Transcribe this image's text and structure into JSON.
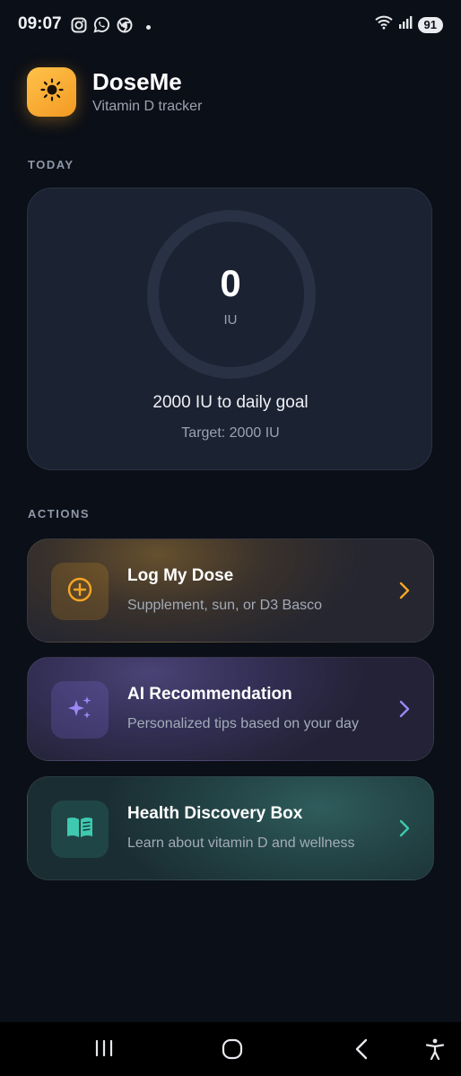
{
  "status_bar": {
    "time": "09:07",
    "battery": "91",
    "left_icons": [
      "instagram-icon",
      "whatsapp-icon",
      "chrome-icon",
      "dot-icon"
    ],
    "right_icons": [
      "wifi-icon",
      "signal-icon",
      "battery-icon"
    ]
  },
  "header": {
    "app_name": "DoseMe",
    "subtitle": "Vitamin D tracker",
    "logo_icon": "sun-icon"
  },
  "today": {
    "section_label": "TODAY",
    "dose_value": "0",
    "dose_unit": "IU",
    "progress_fraction": 0,
    "goal_text": "2000 IU to daily goal",
    "target_text": "Target: 2000 IU"
  },
  "actions": {
    "section_label": "ACTIONS",
    "items": [
      {
        "title": "Log My Dose",
        "description": "Supplement, sun, or D3 Basco",
        "icon": "plus-circle-icon",
        "accent": "#f5a623"
      },
      {
        "title": "AI Recommendation",
        "description": "Personalized tips based on your day",
        "icon": "sparkles-icon",
        "accent": "#9b87f5"
      },
      {
        "title": "Health Discovery Box",
        "description": "Learn about vitamin D and wellness",
        "icon": "book-icon",
        "accent": "#3ec9b0"
      }
    ]
  },
  "nav_bar": {
    "buttons": [
      "recent-apps-icon",
      "home-icon",
      "back-icon",
      "accessibility-icon"
    ]
  },
  "colors": {
    "background": "#0b0f17",
    "card": "#1b2232",
    "ring_track": "#283244",
    "brand_orange": "#f5a623"
  }
}
